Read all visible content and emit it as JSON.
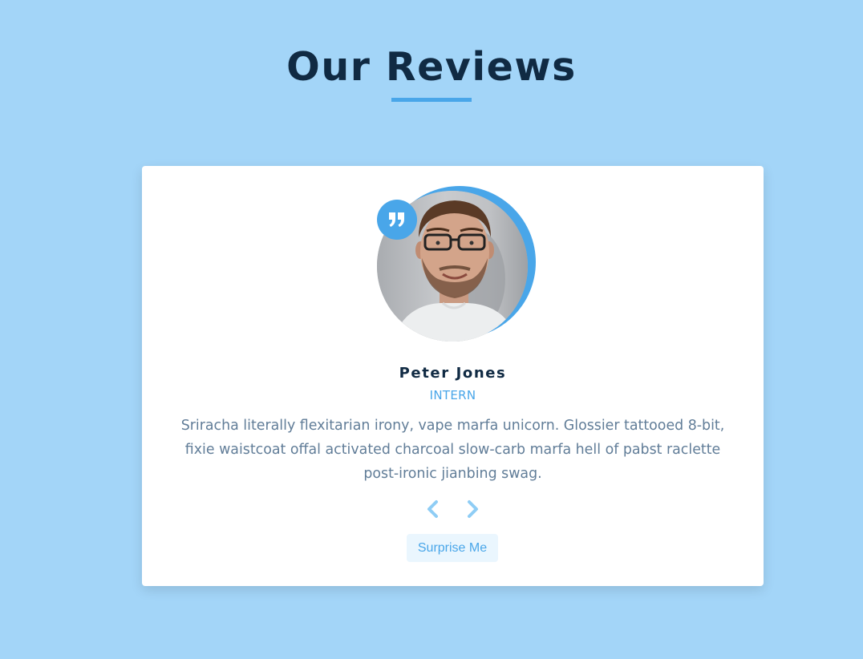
{
  "section": {
    "title": "Our Reviews"
  },
  "review": {
    "author": "Peter Jones",
    "job": "INTERN",
    "text": "Sriracha literally flexitarian irony, vape marfa unicorn. Glossier tattooed 8-bit, fixie waistcoat offal activated charcoal slow-carb marfa hell of pabst raclette post-ironic jianbing swag.",
    "image_alt": "Peter Jones",
    "quote_icon": "quote-right-icon"
  },
  "controls": {
    "prev_icon": "chevron-left-icon",
    "next_icon": "chevron-right-icon",
    "random_label": "Surprise Me"
  },
  "colors": {
    "background": "#a3d5f8",
    "accent": "#49a6e9",
    "heading": "#102a43",
    "body_text": "#617d98",
    "card": "#ffffff",
    "chevron": "#8fcdf5",
    "button_bg": "#eaf6fe"
  }
}
